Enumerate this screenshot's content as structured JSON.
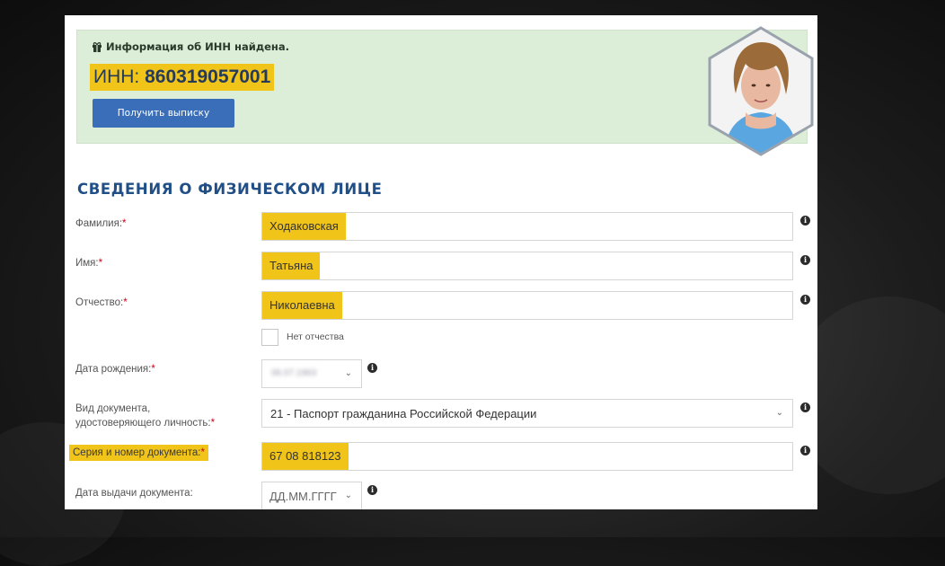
{
  "info": {
    "found_text": "Информация об ИНН найдена.",
    "inn_label": "ИНН:",
    "inn_value": "860319057001",
    "extract_button": "Получить выписку"
  },
  "section_title": "СВЕДЕНИЯ О ФИЗИЧЕСКОМ ЛИЦЕ",
  "required_mark": "*",
  "form": {
    "surname": {
      "label": "Фамилия:",
      "value": "Ходаковская"
    },
    "name": {
      "label": "Имя:",
      "value": "Татьяна"
    },
    "patronymic": {
      "label": "Отчество:",
      "value": "Николаевна"
    },
    "no_patronymic": {
      "label": "Нет отчества",
      "checked": false
    },
    "birth_date": {
      "label": "Дата рождения:",
      "value": "06.07.1963"
    },
    "doc_type": {
      "label_line1": "Вид документа,",
      "label_line2": "удостоверяющего личность:",
      "value": "21 - Паспорт гражданина Российской Федерации"
    },
    "doc_number": {
      "label": "Серия и номер документа:",
      "value": "67 08 818123"
    },
    "issue_date": {
      "label": "Дата выдачи документа:",
      "placeholder": "ДД.ММ.ГГГГ"
    }
  },
  "icons": {
    "gift": "gift-icon",
    "info": "info-icon",
    "chevron": "chevron-down-icon"
  },
  "colors": {
    "highlight": "#f0c419",
    "info_box": "#dcedd8",
    "button": "#3b6eb8",
    "title": "#1f4f86",
    "required": "#d0021b"
  }
}
